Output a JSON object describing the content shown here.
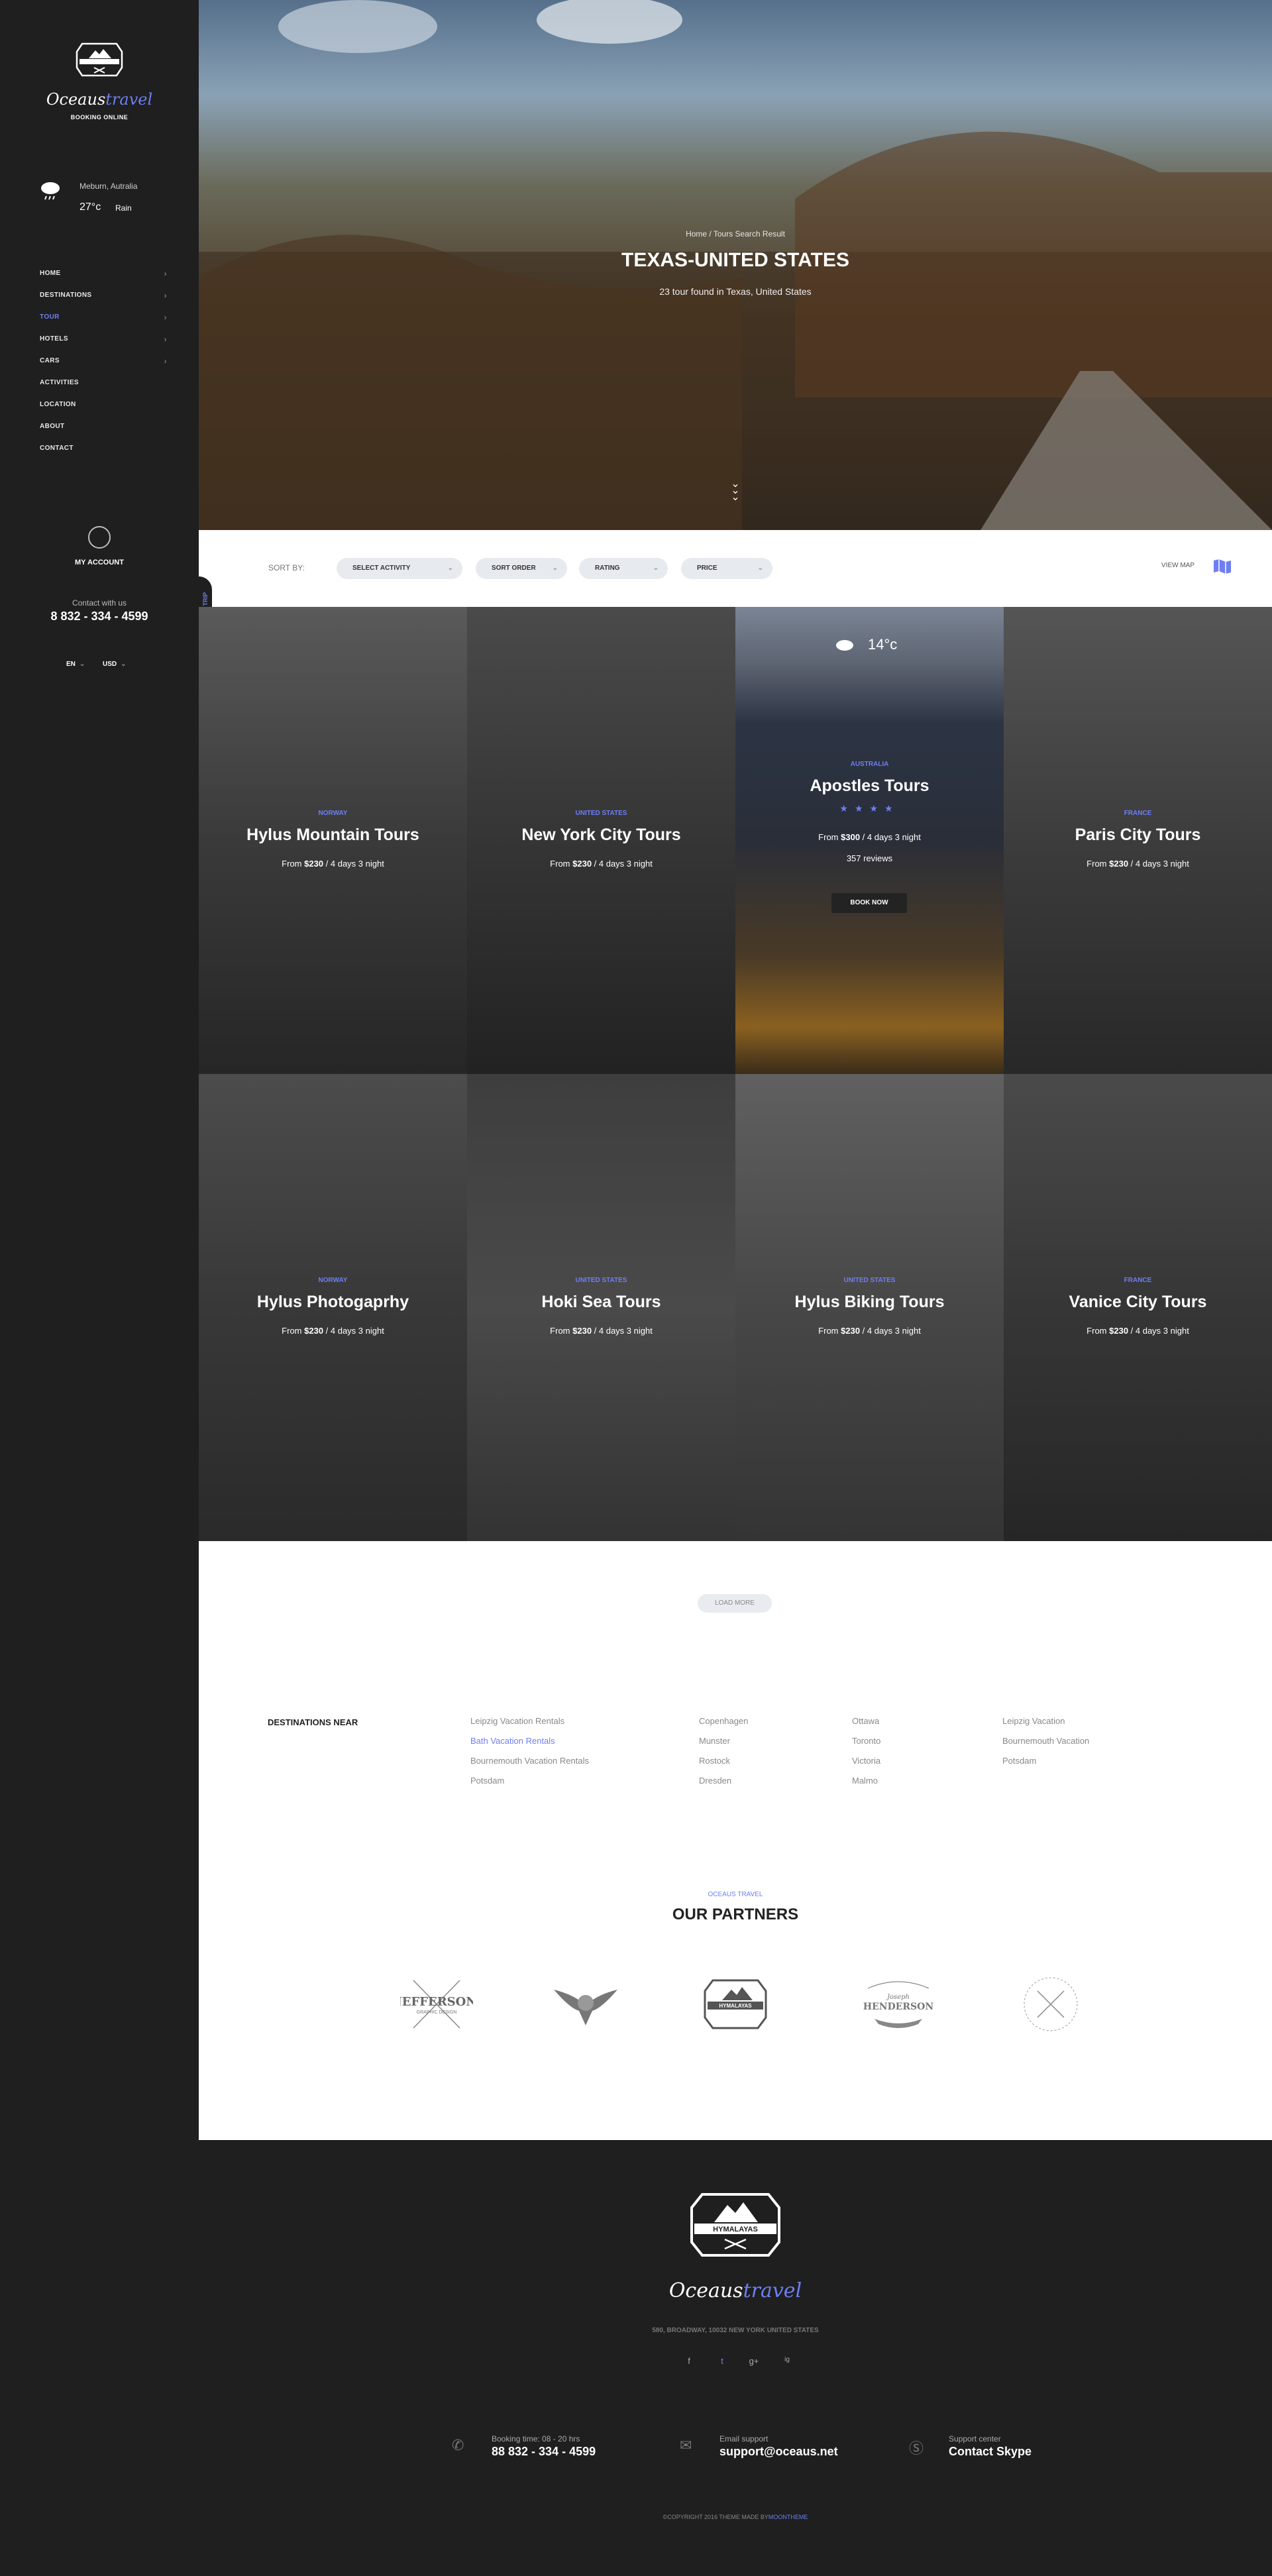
{
  "sidebar": {
    "logo_text": "HYMALAYAS",
    "brand_main": "Oceaus",
    "brand_accent": "travel",
    "brand_sub": "BOOKING ONLINE",
    "weather": {
      "location": "Meburn, Autralia",
      "temp": "27°c",
      "condition": "Rain",
      "icon": "rain-cloud-icon"
    },
    "nav": [
      {
        "label": "HOME",
        "has_children": true,
        "active": false
      },
      {
        "label": "DESTINATIONS",
        "has_children": true,
        "active": false
      },
      {
        "label": "TOUR",
        "has_children": true,
        "active": true
      },
      {
        "label": "HOTELS",
        "has_children": true,
        "active": false
      },
      {
        "label": "CARS",
        "has_children": true,
        "active": false
      },
      {
        "label": "ACTIVITIES",
        "has_children": false,
        "active": false
      },
      {
        "label": "LOCATION",
        "has_children": false,
        "active": false
      },
      {
        "label": "ABOUT",
        "has_children": false,
        "active": false
      },
      {
        "label": "CONTACT",
        "has_children": false,
        "active": false
      }
    ],
    "account_label": "MY ACCOUNT",
    "contact_label": "Contact with us",
    "contact_phone": "8 832 - 334 - 4599",
    "language": "EN",
    "currency": "USD",
    "find_tab": "FIND A TRIP"
  },
  "hero": {
    "breadcrumb": "Home /  Tours Search Result",
    "title": "TEXAS-UNITED STATES",
    "subtitle": "23 tour found in Texas, United States"
  },
  "sortbar": {
    "label": "SORT BY:",
    "filters": [
      "SELECT ACTIVITY",
      "SORT ORDER",
      "RATING",
      "PRICE"
    ],
    "view_map": "VIEW MAP"
  },
  "tours": [
    {
      "country": "NORWAY",
      "name": "Hylus Mountain Tours",
      "price_prefix": "From ",
      "price": "$230",
      "duration": " /  4 days 3 night"
    },
    {
      "country": "UNITED STATES",
      "name": "New York City Tours",
      "price_prefix": "From ",
      "price": "$230",
      "duration": " /  4 days 3 night"
    },
    {
      "country": "AUSTRALIA",
      "name": "Apostles Tours",
      "price_prefix": "From ",
      "price": "$300",
      "duration": " /  4 days 3 night",
      "stars": "★★★★",
      "reviews": "357 reviews",
      "cta": "BOOK NOW",
      "temp": "14°c"
    },
    {
      "country": "FRANCE",
      "name": "Paris City Tours",
      "price_prefix": "From ",
      "price": "$230",
      "duration": " /  4 days 3 night"
    },
    {
      "country": "NORWAY",
      "name": "Hylus Photogaprhy",
      "price_prefix": "From ",
      "price": "$230",
      "duration": " /  4 days 3 night"
    },
    {
      "country": "UNITED STATES",
      "name": "Hoki Sea Tours",
      "price_prefix": "From ",
      "price": "$230",
      "duration": " /  4 days 3 night"
    },
    {
      "country": "UNITED STATES",
      "name": "Hylus Biking Tours",
      "price_prefix": "From ",
      "price": "$230",
      "duration": " /  4 days 3 night"
    },
    {
      "country": "FRANCE",
      "name": "Vanice City Tours",
      "price_prefix": "From ",
      "price": "$230",
      "duration": " /  4 days 3 night"
    }
  ],
  "load_more": "LOAD MORE",
  "destinations": {
    "label": "DESTINATIONS NEAR",
    "columns": [
      [
        "Leipzig Vacation Rentals",
        "Bath Vacation Rentals",
        "Bournemouth Vacation Rentals",
        "Potsdam"
      ],
      [
        "Copenhagen",
        "Munster",
        "Rostock",
        "Dresden"
      ],
      [
        "Ottawa",
        "Toronto",
        "Victoria",
        "Malmo"
      ],
      [
        "Leipzig Vacation",
        "Bournemouth Vacation",
        "Potsdam"
      ]
    ],
    "highlight": "Bath Vacation Rentals"
  },
  "partners": {
    "kicker": "OCEAUS TRAVEL",
    "title": "OUR PARTNERS",
    "logos": [
      {
        "name": "JEFFERSON",
        "sub": "GRAPHIC DESIGN",
        "icon": "jefferson-logo"
      },
      {
        "name": "",
        "sub": "",
        "icon": "eagle-logo"
      },
      {
        "name": "HYMALAYAS",
        "sub": "",
        "icon": "hymalayas-logo"
      },
      {
        "name": "HENDERSON",
        "sub": "Joseph",
        "icon": "henderson-logo"
      },
      {
        "name": "",
        "sub": "",
        "icon": "arrows-badge-logo"
      }
    ]
  },
  "footer": {
    "logo_text": "HYMALAYAS",
    "brand_main": "Oceaus",
    "brand_accent": "travel",
    "address": "580, BROADWAY, 10032 NEW YORK UNITED STATES",
    "social": [
      "f",
      "t",
      "g+",
      "ig"
    ],
    "contacts": [
      {
        "small": "Booking time: 08 - 20 hrs",
        "big": "88 832 - 334 - 4599",
        "icon": "phone-icon"
      },
      {
        "small": "Email support",
        "big": "support@oceaus.net",
        "icon": "mail-icon"
      },
      {
        "small": "Support center",
        "big": "Contact Skype",
        "icon": "skype-icon"
      }
    ],
    "copyright": "©COPYRIGHT 2016 THEME MADE BY",
    "copyright_by": "MOONTHEME"
  },
  "colors": {
    "accent": "#6d7ff3",
    "sidebar_bg": "#1f1f1f"
  }
}
